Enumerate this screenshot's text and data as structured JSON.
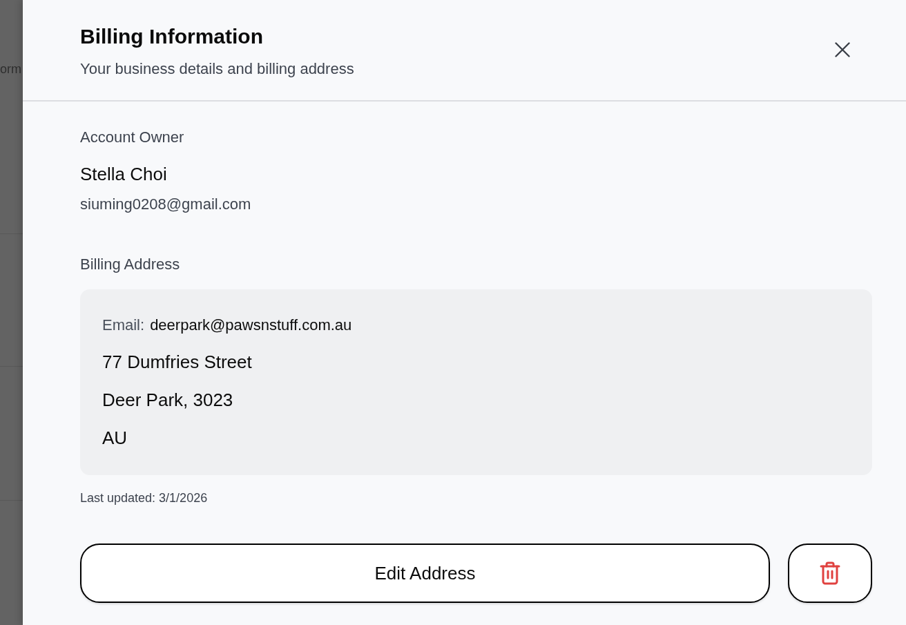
{
  "backdrop": {
    "text": "orm"
  },
  "panel": {
    "title": "Billing Information",
    "subtitle": "Your business details and billing address"
  },
  "account_owner": {
    "label": "Account Owner",
    "name": "Stella Choi",
    "email": "siuming0208@gmail.com"
  },
  "billing_address": {
    "label": "Billing Address",
    "email_label": "Email:",
    "email": "deerpark@pawsnstuff.com.au",
    "lines": [
      "77 Dumfries Street",
      "Deer Park, 3023",
      "AU"
    ]
  },
  "last_updated": "Last updated: 3/1/2026",
  "buttons": [
    {
      "kind": "edit",
      "label": "Edit Address"
    },
    {
      "kind": "delete"
    }
  ]
}
